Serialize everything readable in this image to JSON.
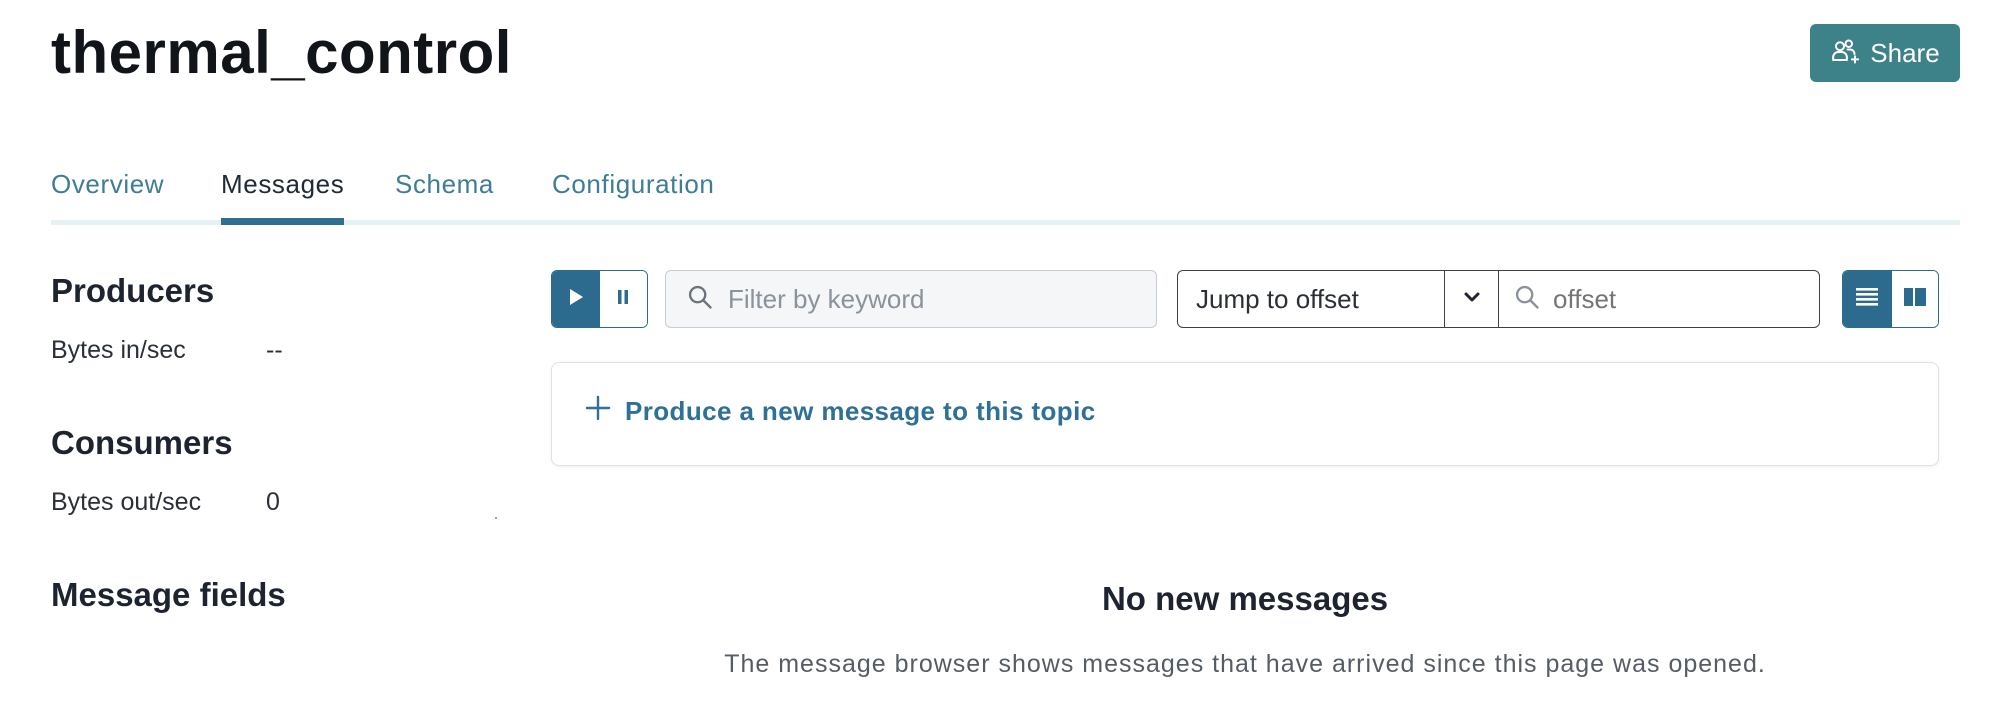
{
  "header": {
    "title": "thermal_control",
    "share_label": "Share",
    "share_icon": "share-users-icon"
  },
  "tabs": [
    {
      "label": "Overview",
      "active": false
    },
    {
      "label": "Messages",
      "active": true
    },
    {
      "label": "Schema",
      "active": false
    },
    {
      "label": "Configuration",
      "active": false
    }
  ],
  "sidebar": {
    "producers": {
      "heading": "Producers",
      "label": "Bytes in/sec",
      "value": "--"
    },
    "consumers": {
      "heading": "Consumers",
      "label": "Bytes out/sec",
      "value": "0"
    },
    "message_fields": {
      "heading": "Message fields"
    }
  },
  "toolbar": {
    "play_icon": "play-icon",
    "pause_icon": "pause-icon",
    "filter_placeholder": "Filter by keyword",
    "jump_label": "Jump to offset",
    "offset_placeholder": "offset",
    "view_list_icon": "list-view-icon",
    "view_split_icon": "split-view-icon"
  },
  "produce": {
    "label": "Produce a new message to this topic"
  },
  "empty_state": {
    "title": "No new messages",
    "description": "The message browser shows messages that have arrived since this page was opened."
  },
  "colors": {
    "accent": "#2c6b8e",
    "share_bg": "#3d8189",
    "tab_link": "#3e7d94"
  }
}
